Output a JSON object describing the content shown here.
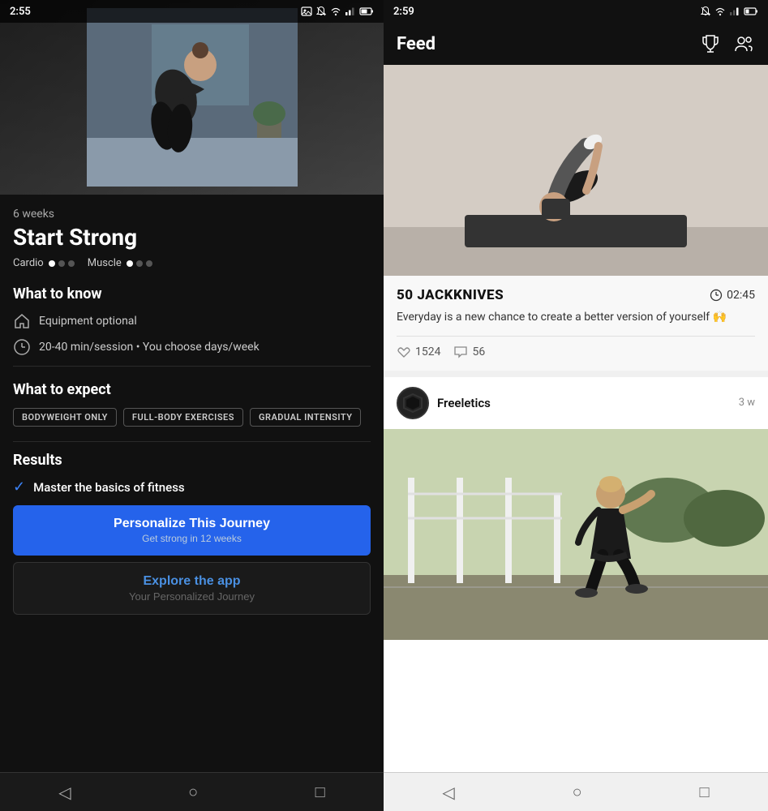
{
  "left": {
    "status": {
      "time": "2:55",
      "icons": [
        "photo-icon",
        "bell-mute-icon",
        "wifi-icon",
        "signal-icon",
        "battery-icon"
      ]
    },
    "hero_alt": "Athlete stretching shoulder",
    "weeks": "6 weeks",
    "title": "Start Strong",
    "tags": [
      {
        "label": "Cardio",
        "dots": [
          true,
          false,
          false
        ]
      },
      {
        "label": "Muscle",
        "dots": [
          true,
          false,
          false
        ]
      }
    ],
    "what_to_know": {
      "heading": "What to know",
      "items": [
        {
          "icon": "home-icon",
          "text": "Equipment optional"
        },
        {
          "icon": "clock-icon",
          "text": "20-40 min/session • You choose days/week"
        }
      ]
    },
    "what_to_expect": {
      "heading": "What to expect",
      "badges": [
        "BODYWEIGHT ONLY",
        "FULL-BODY EXERCISES",
        "GRADUAL INTENSITY"
      ]
    },
    "results": {
      "heading": "Results",
      "items": [
        "Master the basics of fitness"
      ]
    },
    "cta_primary": {
      "main": "Personalize This Journey",
      "sub": "Get strong in 12 weeks"
    },
    "cta_secondary": {
      "link_text": "Explore the app",
      "sub": "Your Personalized Journey"
    },
    "nav": [
      "back-icon",
      "home-circle-icon",
      "square-icon"
    ]
  },
  "right": {
    "status": {
      "time": "2:59",
      "icons": [
        "bell-mute-icon",
        "wifi-icon",
        "signal-icon",
        "battery-icon"
      ]
    },
    "header": {
      "title": "Feed",
      "icons": [
        "trophy-icon",
        "people-icon"
      ]
    },
    "hero_alt": "Athlete doing jackknives",
    "workout_card": {
      "title": "50 JACKKNIVES",
      "time": "02:45",
      "description": "Everyday is a new chance to create a better version of yourself 🙌",
      "likes": "1524",
      "comments": "56"
    },
    "post": {
      "author": "Freeletics",
      "avatar_alt": "Freeletics hexagon logo",
      "time_ago": "3 w",
      "image_alt": "Athlete running on track"
    },
    "nav": [
      "back-icon",
      "home-circle-icon",
      "square-icon"
    ]
  }
}
